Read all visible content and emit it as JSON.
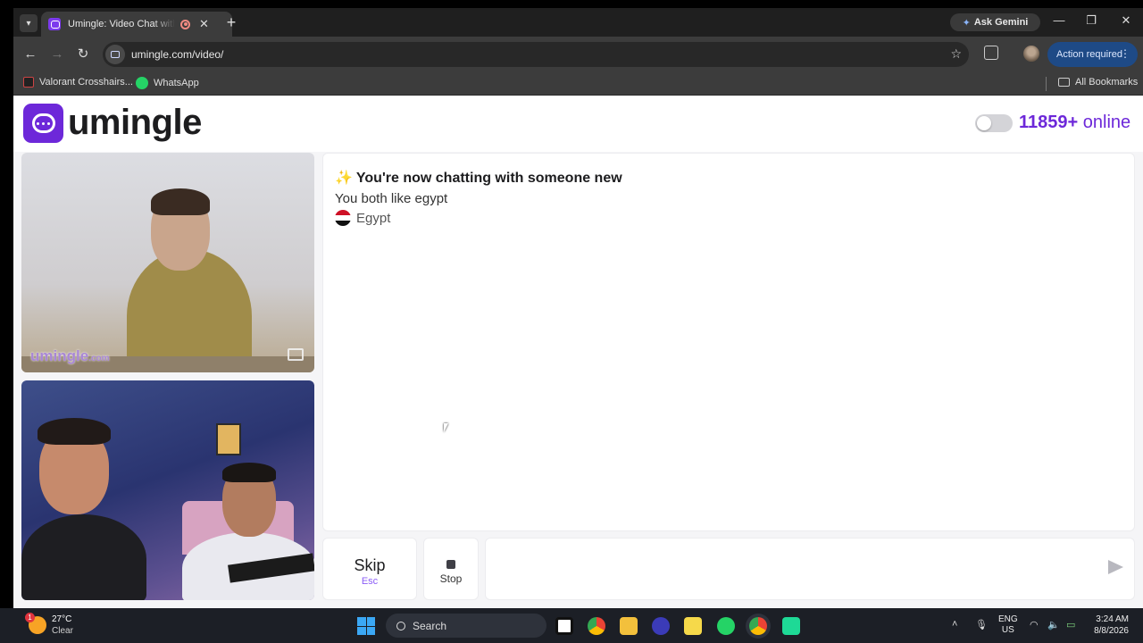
{
  "browser": {
    "tab_title": "Umingle: Video Chat with Strangers",
    "ask_gemini": "Ask Gemini",
    "url": "umingle.com/video/",
    "action_required": "Action required",
    "bookmarks": [
      {
        "label": "Valorant Crosshairs..."
      },
      {
        "label": "WhatsApp"
      }
    ],
    "all_bookmarks": "All Bookmarks"
  },
  "header": {
    "logo_text": "umingle",
    "online_count": "11859+",
    "online_label": "online"
  },
  "video": {
    "watermark": "umingle",
    "watermark_suffix": ".com"
  },
  "chat": {
    "status": "You're now chatting with someone new",
    "common": "You both like egypt",
    "country": "Egypt"
  },
  "controls": {
    "skip_label": "Skip",
    "skip_key": "Esc",
    "stop_label": "Stop",
    "message_placeholder": ""
  },
  "taskbar": {
    "temperature": "27°C",
    "weather": "Clear",
    "weather_badge": "1",
    "search_label": "Search",
    "lang_line1": "ENG",
    "lang_line2": "US",
    "time": "3:24 AM",
    "date": "8/8/2026"
  },
  "colors": {
    "brand": "#6d28d9",
    "accent": "#8b5cf6"
  }
}
